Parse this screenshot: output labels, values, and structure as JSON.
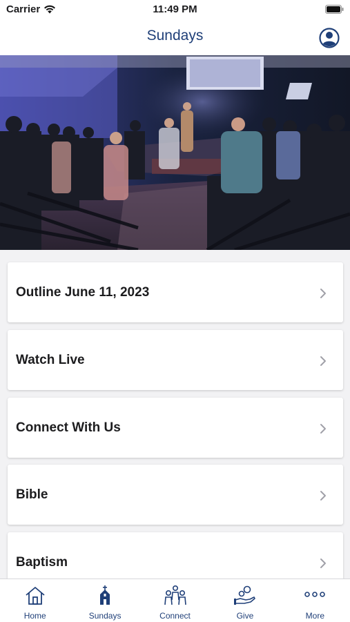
{
  "status_bar": {
    "carrier": "Carrier",
    "time": "11:49 PM"
  },
  "nav": {
    "title": "Sundays",
    "profile_icon": "person-circle-icon"
  },
  "hero": {
    "screen_text": ""
  },
  "menu": {
    "items": [
      {
        "label": "Outline June 11, 2023"
      },
      {
        "label": "Watch Live"
      },
      {
        "label": "Connect With Us"
      },
      {
        "label": "Bible"
      },
      {
        "label": "Baptism"
      }
    ]
  },
  "tabs": [
    {
      "label": "Home",
      "icon": "house-icon"
    },
    {
      "label": "Sundays",
      "icon": "church-icon",
      "active": true
    },
    {
      "label": "Connect",
      "icon": "people-icon"
    },
    {
      "label": "Give",
      "icon": "giving-hand-icon"
    },
    {
      "label": "More",
      "icon": "more-dots-icon"
    }
  ],
  "colors": {
    "accent": "#1f3f78",
    "background": "#f2f2f4",
    "card": "#ffffff"
  }
}
